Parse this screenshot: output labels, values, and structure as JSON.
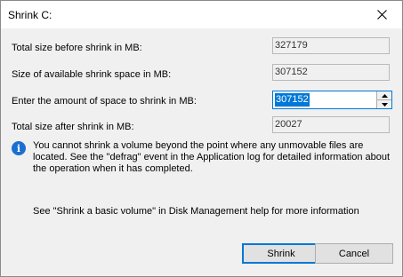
{
  "window": {
    "title": "Shrink C:"
  },
  "fields": {
    "total_before": {
      "label": "Total size before shrink in MB:",
      "value": "327179"
    },
    "available": {
      "label": "Size of available shrink space in MB:",
      "value": "307152"
    },
    "amount": {
      "label": "Enter the amount of space to shrink in MB:",
      "value": "307152"
    },
    "total_after": {
      "label": "Total size after shrink in MB:",
      "value": "20027"
    }
  },
  "info": {
    "text": "You cannot shrink a volume beyond the point where any unmovable files are located. See the \"defrag\" event in the Application log for detailed information about the operation when it has completed."
  },
  "help": {
    "text": "See \"Shrink a basic volume\" in Disk Management help for more information"
  },
  "buttons": {
    "shrink": "Shrink",
    "cancel": "Cancel"
  },
  "colors": {
    "accent": "#0078d7",
    "info": "#1c6fd1"
  }
}
